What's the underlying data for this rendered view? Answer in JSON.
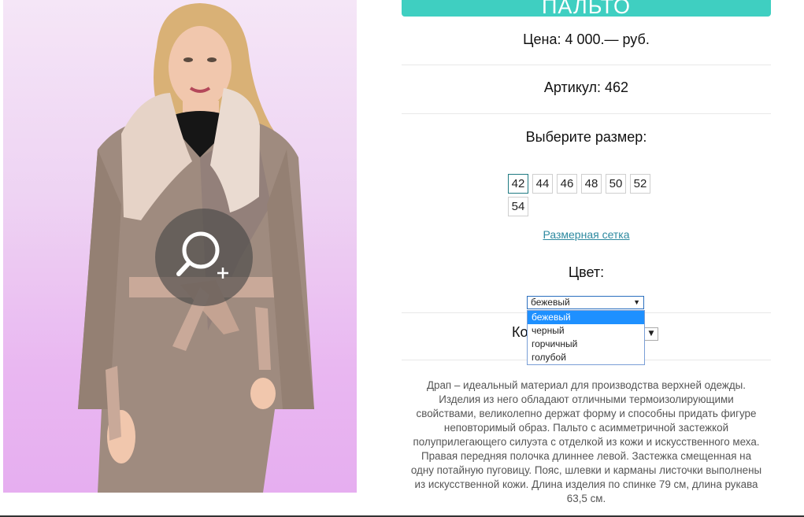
{
  "product": {
    "title": "ПАЛЬТО",
    "price": "Цена: 4 000.— руб.",
    "sku": "Артикул: 462"
  },
  "size": {
    "heading": "Выберите размер:",
    "options": [
      "42",
      "44",
      "46",
      "48",
      "50",
      "52",
      "54"
    ],
    "selected": "42",
    "chart_link": "Размерная сетка"
  },
  "color": {
    "heading": "Цвет:",
    "selected": "бежевый",
    "options": [
      "бежевый",
      "черный",
      "горчичный",
      "голубой"
    ]
  },
  "quantity": {
    "label_visible": "Ко"
  },
  "description": "Драп – идеальный материал для производства верхней одежды. Изделия из него обладают отличными термоизолирующими свойствами, великолепно держат форму и способны придать фигуре неповторимый образ. Пальто с асимметричной застежкой полуприлегающего силуэта с отделкой из кожи и искусственного меха. Правая передняя полочка длиннее левой. Застежка смещенная на одну потайную пуговицу. Пояс, шлевки и карманы листочки выполнены из искусственной кожи. Длина изделия по спинке 79 см, длина рукава 63,5 см.",
  "icons": {
    "zoom": "zoom-in-icon",
    "dropdown": "triangle-down-icon"
  },
  "colors": {
    "accent": "#3fcfc1",
    "link": "#2e8aa0",
    "dropdown_highlight": "#1e90ff"
  }
}
